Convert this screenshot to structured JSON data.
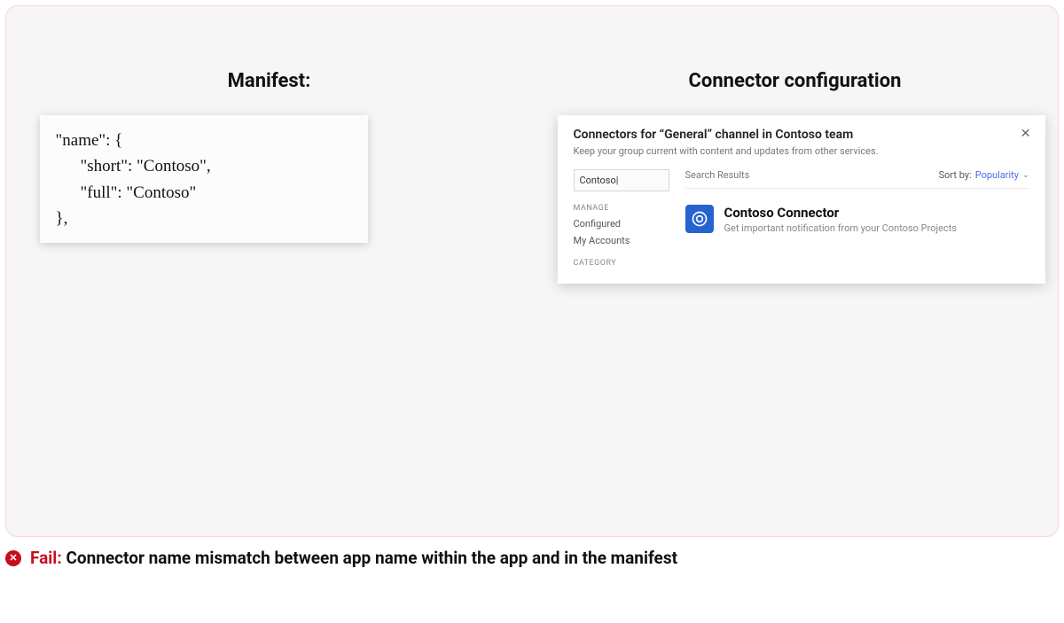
{
  "left": {
    "title": "Manifest:",
    "code": {
      "l1": "\"name\": {",
      "l2": "\"short\": \"Contoso\",",
      "l3": "\"full\": \"Contoso\"",
      "l4": "},"
    }
  },
  "right": {
    "title": "Connector configuration",
    "card": {
      "heading": "Connectors for “General” channel in Contoso team",
      "subheading": "Keep your group current with content and updates from other services.",
      "search_value": "Contoso|",
      "sidebar": {
        "manage_label": "MANAGE",
        "configured": "Configured",
        "my_accounts": "My Accounts",
        "category_label": "CATEGORY"
      },
      "main": {
        "search_results_label": "Search Results",
        "sort_label": "Sort by:",
        "sort_value": "Popularity",
        "connector": {
          "name": "Contoso Connector",
          "description": "Get important notification from your Contoso Projects"
        }
      }
    }
  },
  "fail": {
    "prefix": "Fail:",
    "message": "Connector name mismatch between app name within the app and in the manifest"
  }
}
